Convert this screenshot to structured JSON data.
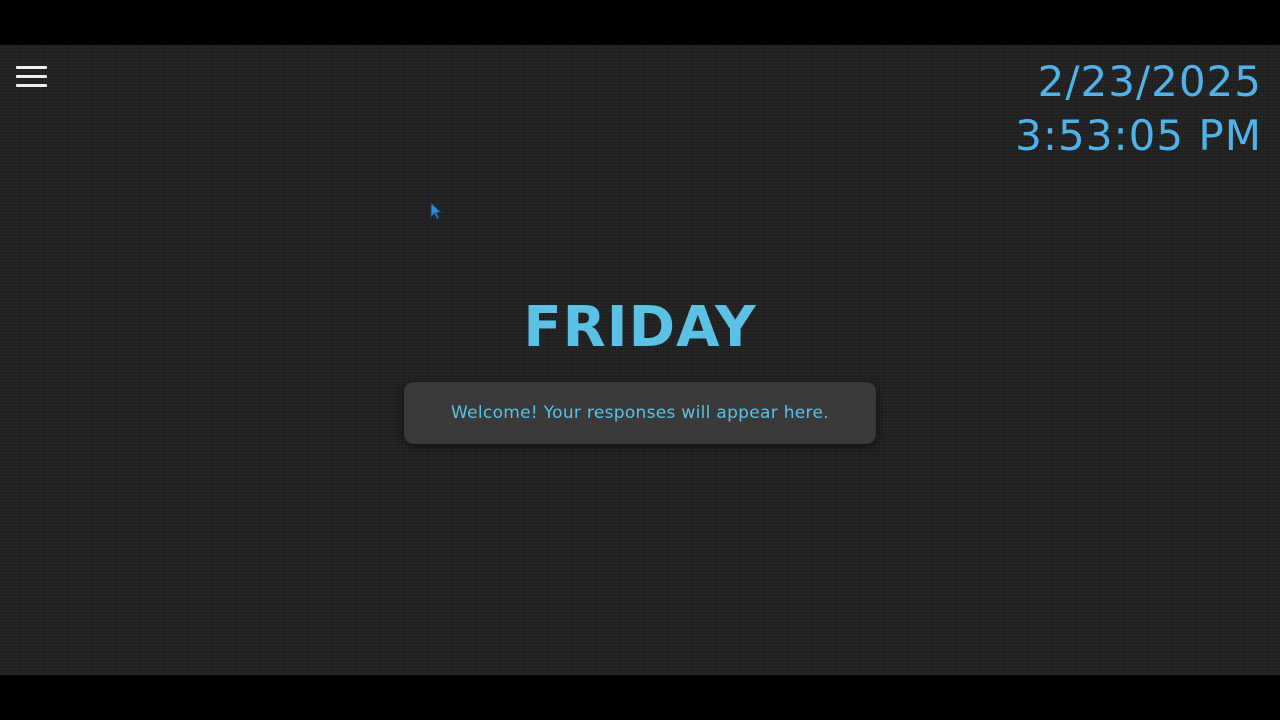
{
  "header": {
    "menu_icon": "hamburger-menu-icon",
    "date": "2/23/2025",
    "time": "3:53:05 PM"
  },
  "main": {
    "title": "FRIDAY",
    "response_text": "Welcome! Your responses will appear here."
  },
  "colors": {
    "accent": "#4fb3ea",
    "title": "#5bc2e6",
    "background": "#232323",
    "panel": "#3a3a3a",
    "menu_icon": "#f0f0f0"
  }
}
